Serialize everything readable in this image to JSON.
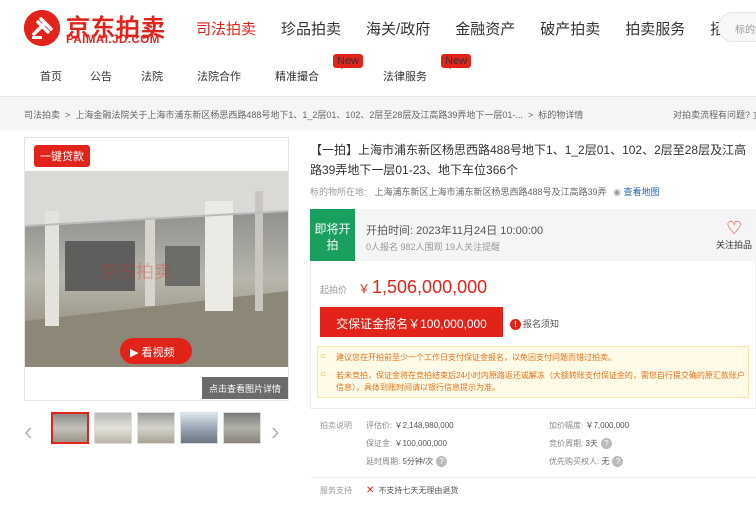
{
  "brand": {
    "logo_cn": "京东拍卖",
    "logo_en": "PAIMAI.JD.COM",
    "color": "#e2231a"
  },
  "top_nav": [
    "司法拍卖",
    "珍品拍卖",
    "海关/政府",
    "金融资产",
    "破产拍卖",
    "拍卖服务",
    "招标采购"
  ],
  "search": {
    "placeholder": "标的物"
  },
  "sub_nav": [
    {
      "label": "首页"
    },
    {
      "label": "公告"
    },
    {
      "label": "法院"
    },
    {
      "label": "法院合作"
    },
    {
      "label": "精准撮合",
      "badge": "New"
    },
    {
      "label": "法律服务",
      "badge": "New"
    }
  ],
  "breadcrumb": {
    "items": [
      "司法拍卖",
      "上海金融法院关于上海市浦东新区杨思西路488号地下1、1_2层01、102、2层至28层及江高路39弄地下一层01-...",
      "标的物详情"
    ],
    "right": "对拍卖流程有问题? 立"
  },
  "gallery": {
    "loan_tag": "一键贷款",
    "video_label": "看视频",
    "detail_link": "点击查看图片详情",
    "watermark": "京东拍卖"
  },
  "item": {
    "title": "【一拍】上海市浦东新区杨思西路488号地下1、1_2层01、102、2层至28层及江高路39弄地下一层01-23、地下车位366个",
    "location_label": "标的物所在地:",
    "location": "上海浦东新区上海市浦东新区杨思西路488号及江高路39弄",
    "map_link": "查看地图"
  },
  "status": {
    "label": "即将开拍",
    "start_time": "开拍时间:  2023年11月24日 10:00:00",
    "stats": "0人报名    982人围观    19人关注提醒",
    "follow": "关注拍品",
    "color": "#1aa05e"
  },
  "price": {
    "label": "起拍价",
    "currency": "￥",
    "value": "1,506,000,000"
  },
  "deposit": {
    "button": "交保证金报名￥100,000,000",
    "notice": "报名须知"
  },
  "tips": [
    "建议您在开拍前至少一个工作日支付保证金报名，以免因支付问题而错过拍卖。",
    "若未竞拍，保证金将在竞拍结束后24小时内原路返还或解冻（大额转账支付保证金的，需您自行提交确的原汇款账户信息），具体到账时间请以银行信息提示为准。"
  ],
  "params": {
    "section_label": "拍卖说明",
    "left": [
      {
        "k": "评估价:",
        "v": "￥2,148,980,000"
      },
      {
        "k": "保证金:",
        "v": "￥100,000,000"
      },
      {
        "k": "延时周期:",
        "v": "5分钟/次"
      }
    ],
    "right": [
      {
        "k": "加价幅度:",
        "v": "￥7,000,000"
      },
      {
        "k": "竞价周期:",
        "v": "3天"
      },
      {
        "k": "优先购买权人:",
        "v": "无"
      }
    ]
  },
  "service": {
    "label": "服务支持",
    "text": "不支持七天无理由退货"
  }
}
